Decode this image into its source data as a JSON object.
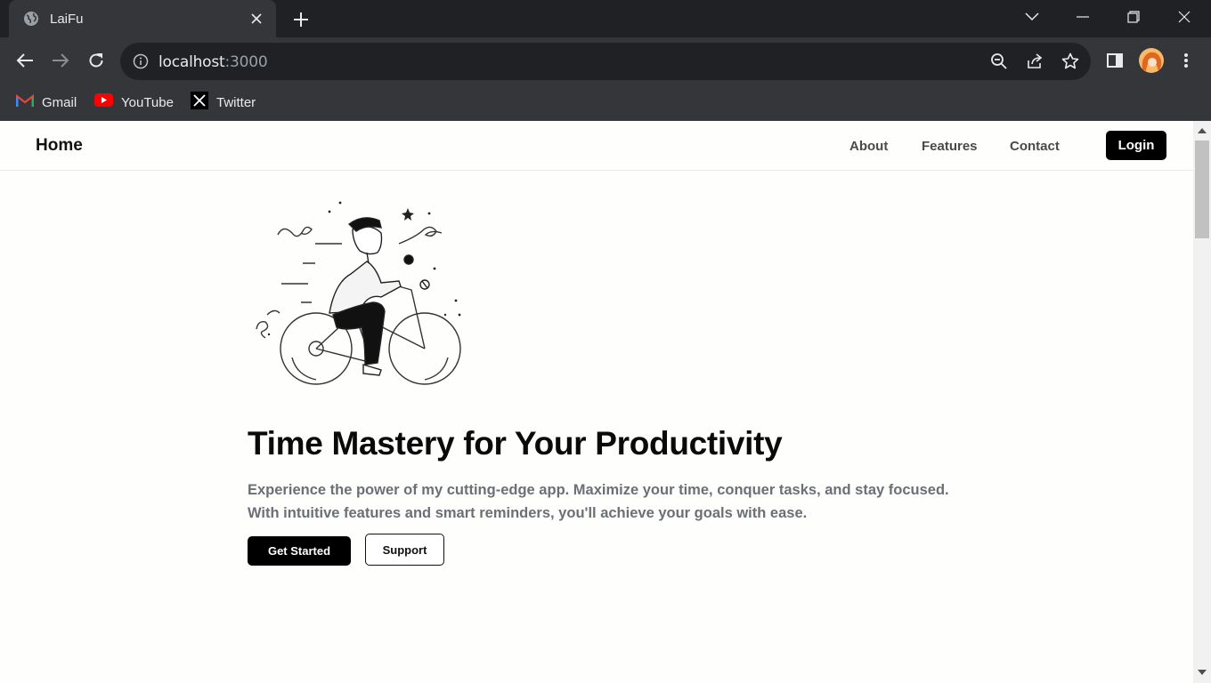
{
  "tab": {
    "title": "LaiFu"
  },
  "address_bar": {
    "host": "localhost",
    "port": ":3000"
  },
  "bookmarks": [
    {
      "label": "Gmail",
      "icon": "gmail-icon"
    },
    {
      "label": "YouTube",
      "icon": "youtube-icon"
    },
    {
      "label": "Twitter",
      "icon": "x-twitter-icon"
    }
  ],
  "nav": {
    "brand": "Home",
    "links": [
      "About",
      "Features",
      "Contact"
    ],
    "login": "Login"
  },
  "hero": {
    "title": "Time Mastery for Your Productivity",
    "text_line1": "Experience the power of my cutting-edge app. Maximize your time, conquer tasks, and stay focused.",
    "text_line2": "With intuitive features and smart reminders, you'll achieve your goals with ease.",
    "primary_button": "Get Started",
    "secondary_button": "Support",
    "illustration": "cyclist-illustration"
  },
  "colors": {
    "chrome_dark": "#202124",
    "chrome_toolbar": "#35363a",
    "page_bg": "#fefefc",
    "primary_button": "#000000",
    "body_text": "#6b6f76"
  }
}
